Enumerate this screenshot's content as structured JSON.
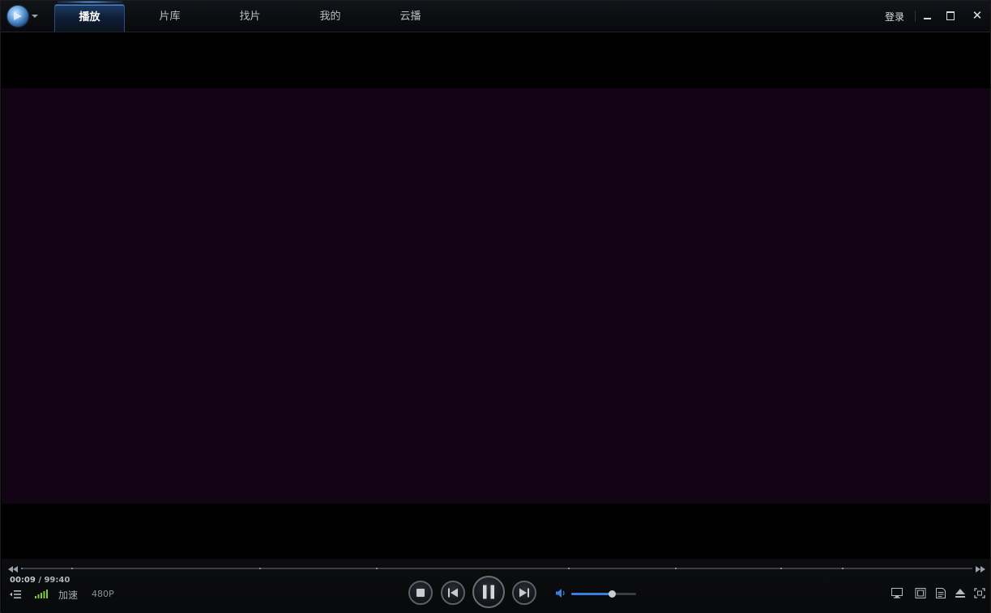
{
  "app": {
    "logo_icon": "player-logo-icon"
  },
  "tabs": [
    {
      "label": "播放",
      "active": true
    },
    {
      "label": "片库",
      "active": false
    },
    {
      "label": "找片",
      "active": false
    },
    {
      "label": "我的",
      "active": false
    },
    {
      "label": "云播",
      "active": false
    }
  ],
  "window": {
    "login_label": "登录",
    "minimize_icon": "minimize-icon",
    "maximize_icon": "maximize-icon",
    "close_icon": "close-icon",
    "close_glyph": "✕"
  },
  "playback": {
    "current_time": "00:09",
    "total_time": "/ 99:40",
    "progress_fraction": 0.0015,
    "chapter_marks": [
      0.053,
      0.25,
      0.373,
      0.575,
      0.687,
      0.798,
      0.863
    ],
    "speed_label": "加速",
    "quality_label": "480P",
    "volume_fraction": 0.62
  },
  "colors": {
    "accent": "#3f7fd6",
    "video_background": "#120414",
    "signal_bars": "#7ec832"
  },
  "icons": {
    "seek_back": "rewind-icon",
    "seek_forward": "fast-forward-icon",
    "playlist": "playlist-icon",
    "signal": "signal-strength-icon",
    "stop": "stop-icon",
    "previous": "previous-icon",
    "pause": "pause-icon",
    "next": "next-icon",
    "volume": "volume-icon",
    "screen": "monitor-icon",
    "window_mode": "window-mode-icon",
    "subtitle": "document-icon",
    "eject": "eject-icon",
    "fullscreen": "fullscreen-icon"
  }
}
